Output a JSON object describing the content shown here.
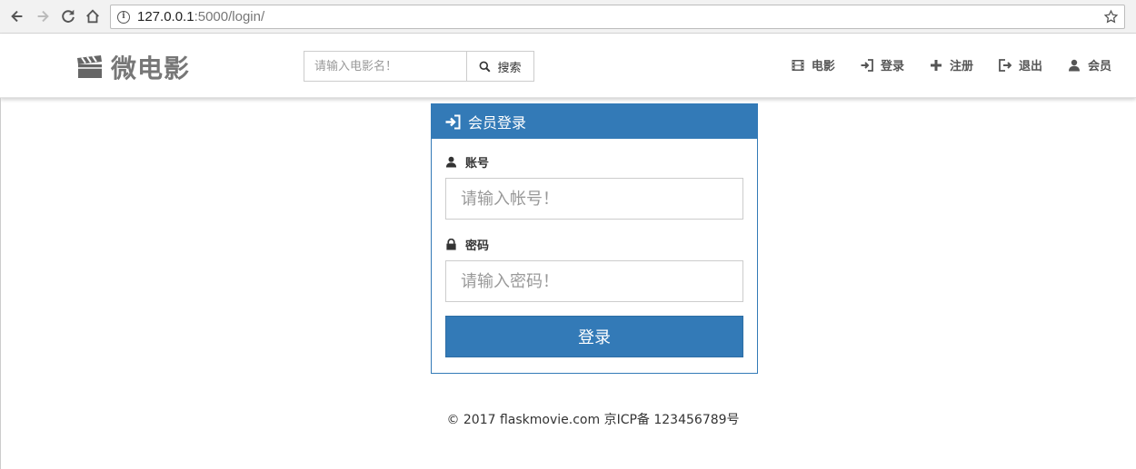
{
  "browser": {
    "url_host": "127.0.0.1",
    "url_rest": ":5000/login/"
  },
  "header": {
    "brand": "微电影",
    "search": {
      "placeholder": "请输入电影名！",
      "button_label": "搜索"
    },
    "nav": [
      {
        "label": "电影",
        "icon": "film-icon"
      },
      {
        "label": "登录",
        "icon": "log-in-icon"
      },
      {
        "label": "注册",
        "icon": "plus-icon"
      },
      {
        "label": "退出",
        "icon": "log-out-icon"
      },
      {
        "label": "会员",
        "icon": "user-icon"
      }
    ]
  },
  "login": {
    "title": "会员登录",
    "account_label": "账号",
    "account_placeholder": "请输入帐号！",
    "password_label": "密码",
    "password_placeholder": "请输入密码！",
    "submit_label": "登录"
  },
  "footer": {
    "text": "© 2017 flaskmovie.com 京ICP备 123456789号"
  },
  "colors": {
    "primary": "#337ab7",
    "brand_gray": "#777777"
  }
}
